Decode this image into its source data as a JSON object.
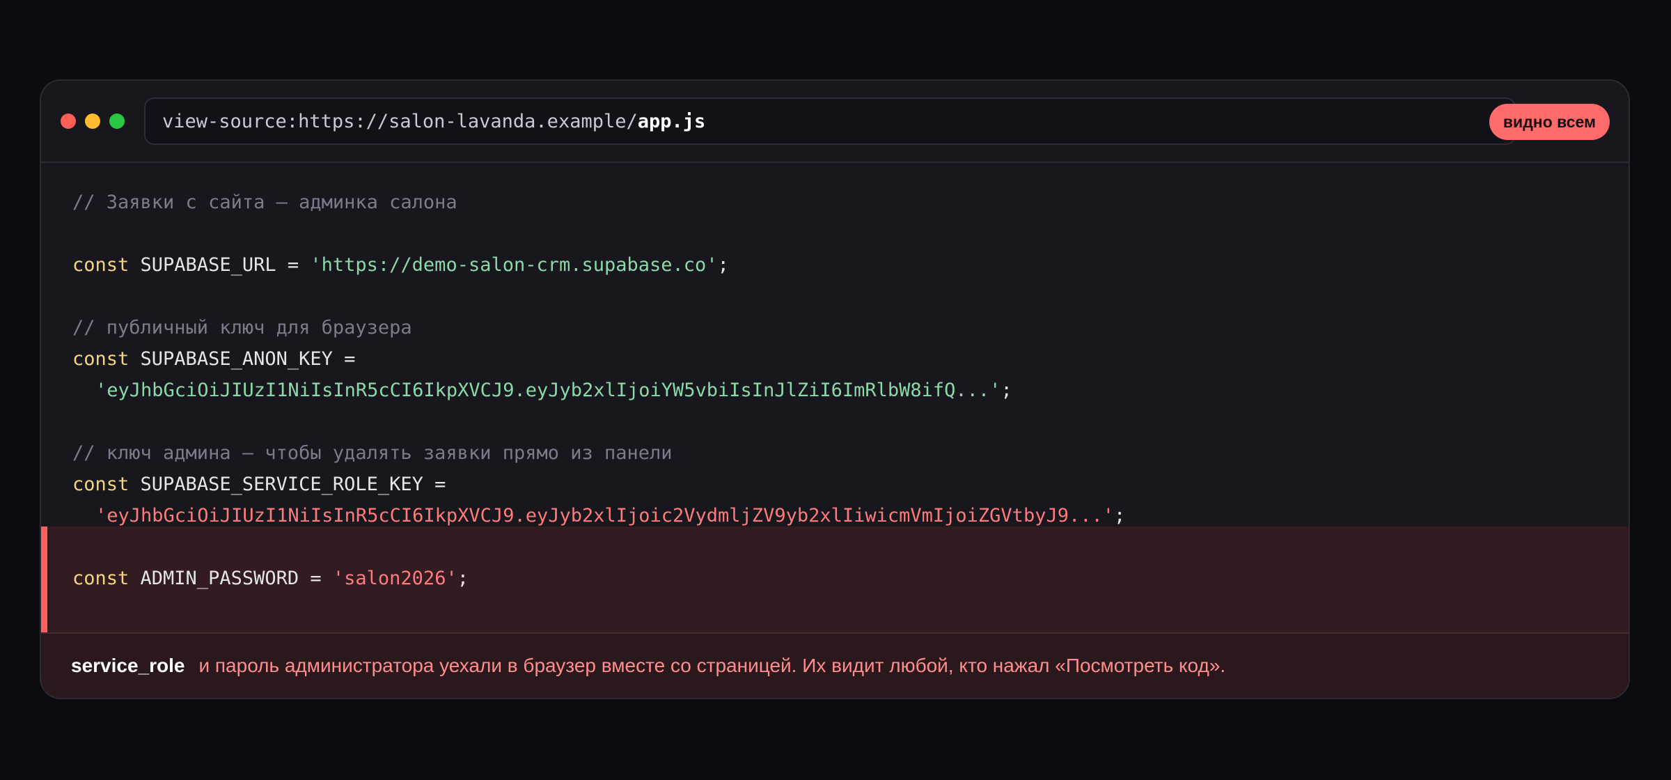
{
  "titlebar": {
    "url_prefix": "view-source:https://salon-lavanda.example/",
    "url_file": "app.js",
    "badge": "видно всем"
  },
  "code": {
    "comment_1": "// Заявки с сайта — админка салона",
    "kw_const": "const",
    "url_decl": " SUPABASE_URL = ",
    "url_value": "'https://demo-salon-crm.supabase.co'",
    "semicolon": ";",
    "comment_2": "// публичный ключ для браузера",
    "anon_decl": " SUPABASE_ANON_KEY =",
    "anon_value": "'eyJhbGciOiJIUzI1NiIsInR5cCI6IkpXVCJ9.eyJyb2xlIjoiYW5vbiIsInJlZiI6ImRlbW8ifQ...'",
    "comment_3": "// ключ админа — чтобы удалять заявки прямо из панели",
    "service_decl": " SUPABASE_SERVICE_ROLE_KEY =",
    "service_value": "'eyJhbGciOiJIUzI1NiIsInR5cCI6IkpXVCJ9.eyJyb2xlIjoic2VydmljZV9yb2xlIiwicmVmIjoiZGVtbyJ9...'",
    "password_decl": " ADMIN_PASSWORD = ",
    "password_value": "'salon2026'"
  },
  "footer": {
    "term": "service_role",
    "message": "и пароль администратора уехали в браузер вместе со страницей. Их видит любой, кто нажал «Посмотреть код»."
  },
  "colors": {
    "accent_danger": "#ff6b6b",
    "keyword": "#f4d47c",
    "string": "#8ad9a8",
    "comment": "#7b7b8c"
  }
}
